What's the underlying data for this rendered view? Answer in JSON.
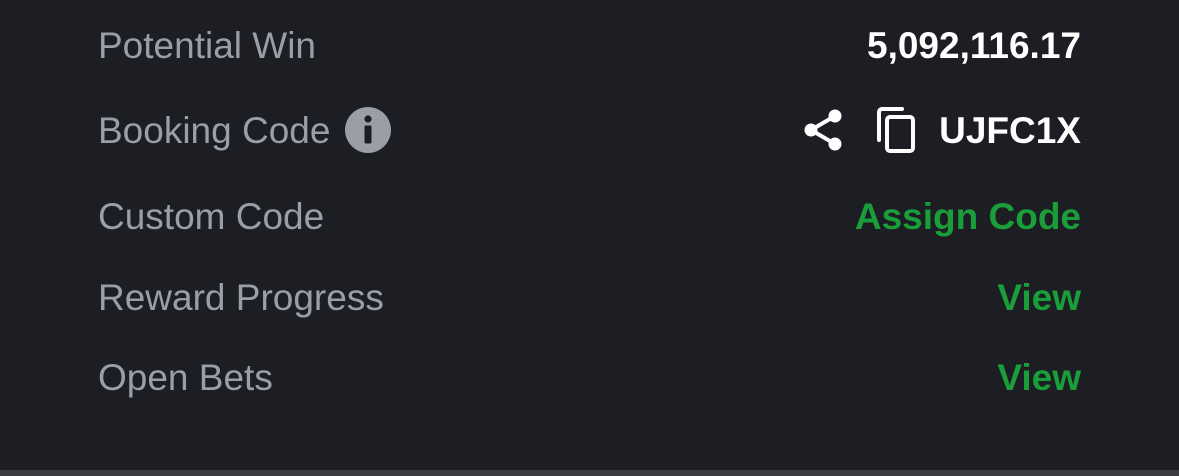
{
  "colors": {
    "background": "#1c1e23",
    "label": "#9a9ea7",
    "value": "#ffffff",
    "accent_green": "#1a9e3a",
    "divider": "#3a3c42"
  },
  "rows": {
    "potential_win": {
      "label": "Potential Win",
      "value": "5,092,116.17"
    },
    "booking_code": {
      "label": "Booking Code",
      "info_icon": "info-icon",
      "share_icon": "share-icon",
      "copy_icon": "copy-icon",
      "value": "UJFC1X"
    },
    "custom_code": {
      "label": "Custom Code",
      "action": "Assign Code"
    },
    "reward_progress": {
      "label": "Reward Progress",
      "action": "View"
    },
    "open_bets": {
      "label": "Open Bets",
      "action": "View"
    }
  }
}
